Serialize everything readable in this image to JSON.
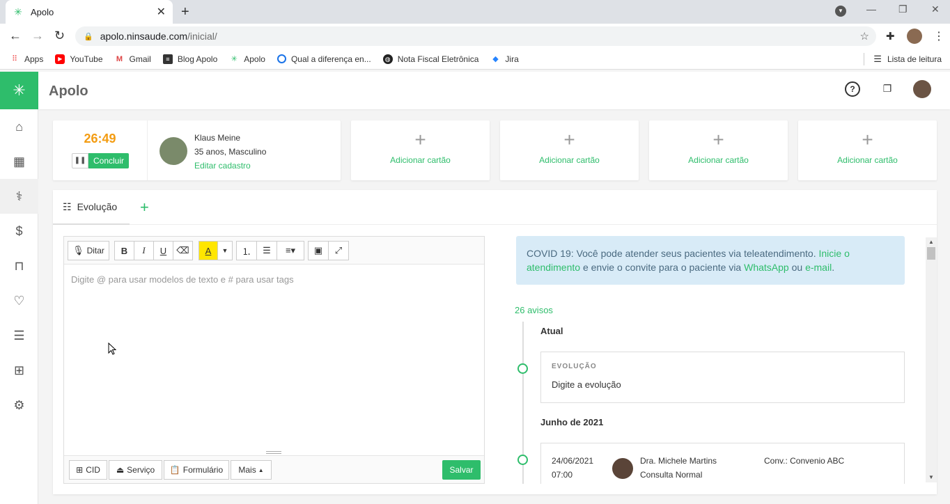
{
  "browser": {
    "tab_title": "Apolo",
    "url_host": "apolo.ninsaude.com",
    "url_path": "/inicial/",
    "bookmarks": [
      "Apps",
      "YouTube",
      "Gmail",
      "Blog Apolo",
      "Apolo",
      "Qual a diferença en...",
      "Nota Fiscal Eletrônica",
      "Jira"
    ],
    "reading_list": "Lista de leitura"
  },
  "app": {
    "brand": "Apolo"
  },
  "consult": {
    "timer": "26:49",
    "conclude_label": "Concluir"
  },
  "patient": {
    "name": "Klaus Meine",
    "info": "35 anos, Masculino",
    "edit_label": "Editar cadastro"
  },
  "add_cards": [
    "Adicionar cartão",
    "Adicionar cartão",
    "Adicionar cartão",
    "Adicionar cartão"
  ],
  "tabs": {
    "evolution": "Evolução"
  },
  "editor": {
    "dictate": "Ditar",
    "placeholder": "Digite @ para usar modelos de texto e # para usar tags",
    "footer": {
      "cid": "CID",
      "service": "Serviço",
      "form": "Formulário",
      "more": "Mais",
      "save": "Salvar"
    }
  },
  "covid": {
    "text1": "COVID 19: Você pode atender seus pacientes via teleatendimento.",
    "link1": "Inicie o atendimento",
    "text2": "e envie o convite para o paciente via",
    "link2": "WhatsApp",
    "text3": "ou",
    "link3": "e-mail",
    "text4": "."
  },
  "timeline": {
    "avisos": "26 avisos",
    "current_heading": "Atual",
    "evo_tag": "EVOLUÇÃO",
    "evo_prompt": "Digite a evolução",
    "month_heading": "Junho de 2021",
    "entry": {
      "date": "24/06/2021",
      "time": "07:00",
      "doctor": "Dra. Michele Martins",
      "type": "Consulta Normal",
      "insurance": "Conv.: Convenio ABC"
    }
  },
  "colors": {
    "brand_green": "#2ebd6b",
    "timer_orange": "#f39c12",
    "info_blue_bg": "#d8ebf7"
  }
}
